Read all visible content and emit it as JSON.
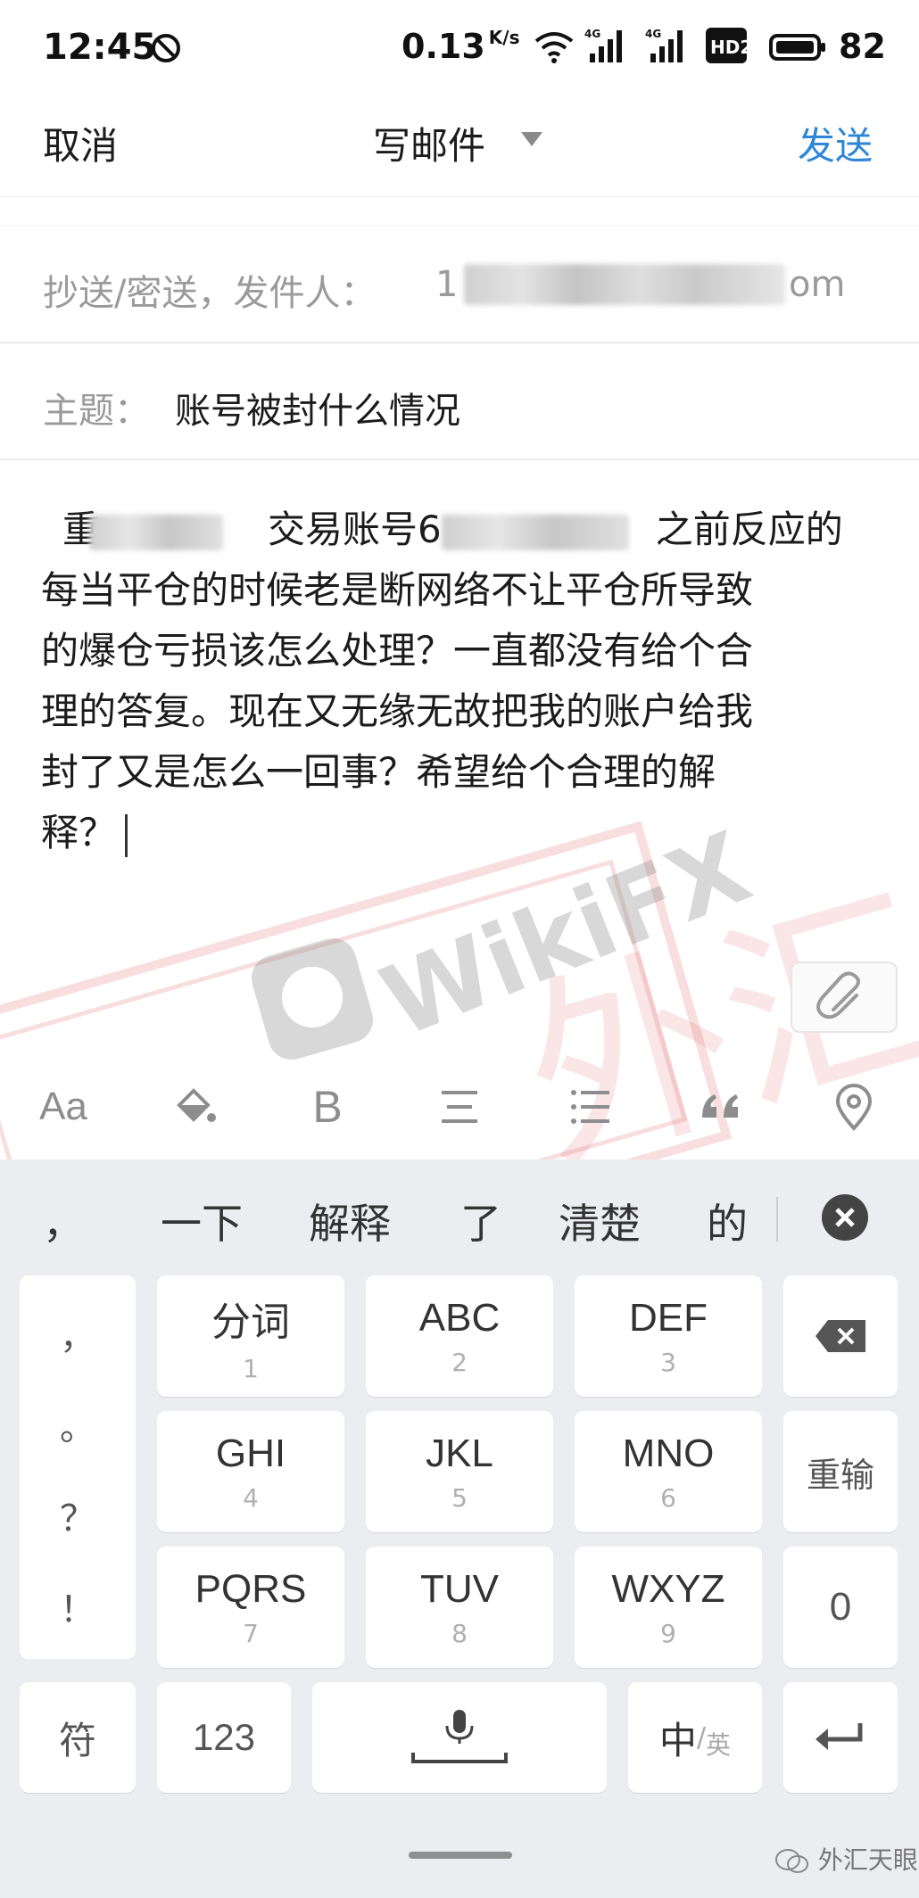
{
  "status_bar": {
    "time": "12:45",
    "net_speed": "0.13",
    "net_speed_unit": "K/s",
    "battery": "82",
    "net_type_1": "4G",
    "net_type_2": "4G",
    "hd_badge": "HD2"
  },
  "header": {
    "cancel_label": "取消",
    "title": "写邮件",
    "send_label": "发送",
    "accent_color": "#2e86d6"
  },
  "fields": {
    "cc_label": "抄送/密送，发件人：",
    "sender_prefix": "1",
    "sender_suffix": "om",
    "subject_label": "主题：",
    "subject_value": "账号被封什么情况"
  },
  "body": {
    "line1_start": "重",
    "line1_mid": "交易账号6",
    "line1_end": "之前反应的",
    "line2": "每当平仓的时候老是断网络不让平仓所导致",
    "line3": "的爆仓亏损该怎么处理？一直都没有给个合",
    "line4": "理的答复。现在又无缘无故把我的账户给我",
    "line5": "封了又是怎么一回事？希望给个合理的解",
    "line6": "释？"
  },
  "watermark": {
    "brand": "WikiFX",
    "chinese": "外汇天眼"
  },
  "format_toolbar": {
    "font_label": "Aa",
    "bold_label": "B",
    "icons": [
      "font-size-icon",
      "fill-color-icon",
      "bold-icon",
      "align-icon",
      "list-icon",
      "quote-icon",
      "location-icon"
    ]
  },
  "keyboard": {
    "candidates": [
      "，",
      "一下",
      "解释",
      "了",
      "清楚",
      "的"
    ],
    "side_symbols": [
      "，",
      "。",
      "？",
      "！"
    ],
    "keys": [
      {
        "main": "分词",
        "num": "1"
      },
      {
        "main": "ABC",
        "num": "2"
      },
      {
        "main": "DEF",
        "num": "3"
      },
      {
        "main": "GHI",
        "num": "4"
      },
      {
        "main": "JKL",
        "num": "5"
      },
      {
        "main": "MNO",
        "num": "6"
      },
      {
        "main": "PQRS",
        "num": "7"
      },
      {
        "main": "TUV",
        "num": "8"
      },
      {
        "main": "WXYZ",
        "num": "9"
      }
    ],
    "reinput_label": "重输",
    "zero_label": "0",
    "symbol_label": "符",
    "numeric_label": "123",
    "lang_main": "中",
    "lang_sep": "/",
    "lang_alt": "英"
  },
  "corner_logo": "外汇天眼"
}
